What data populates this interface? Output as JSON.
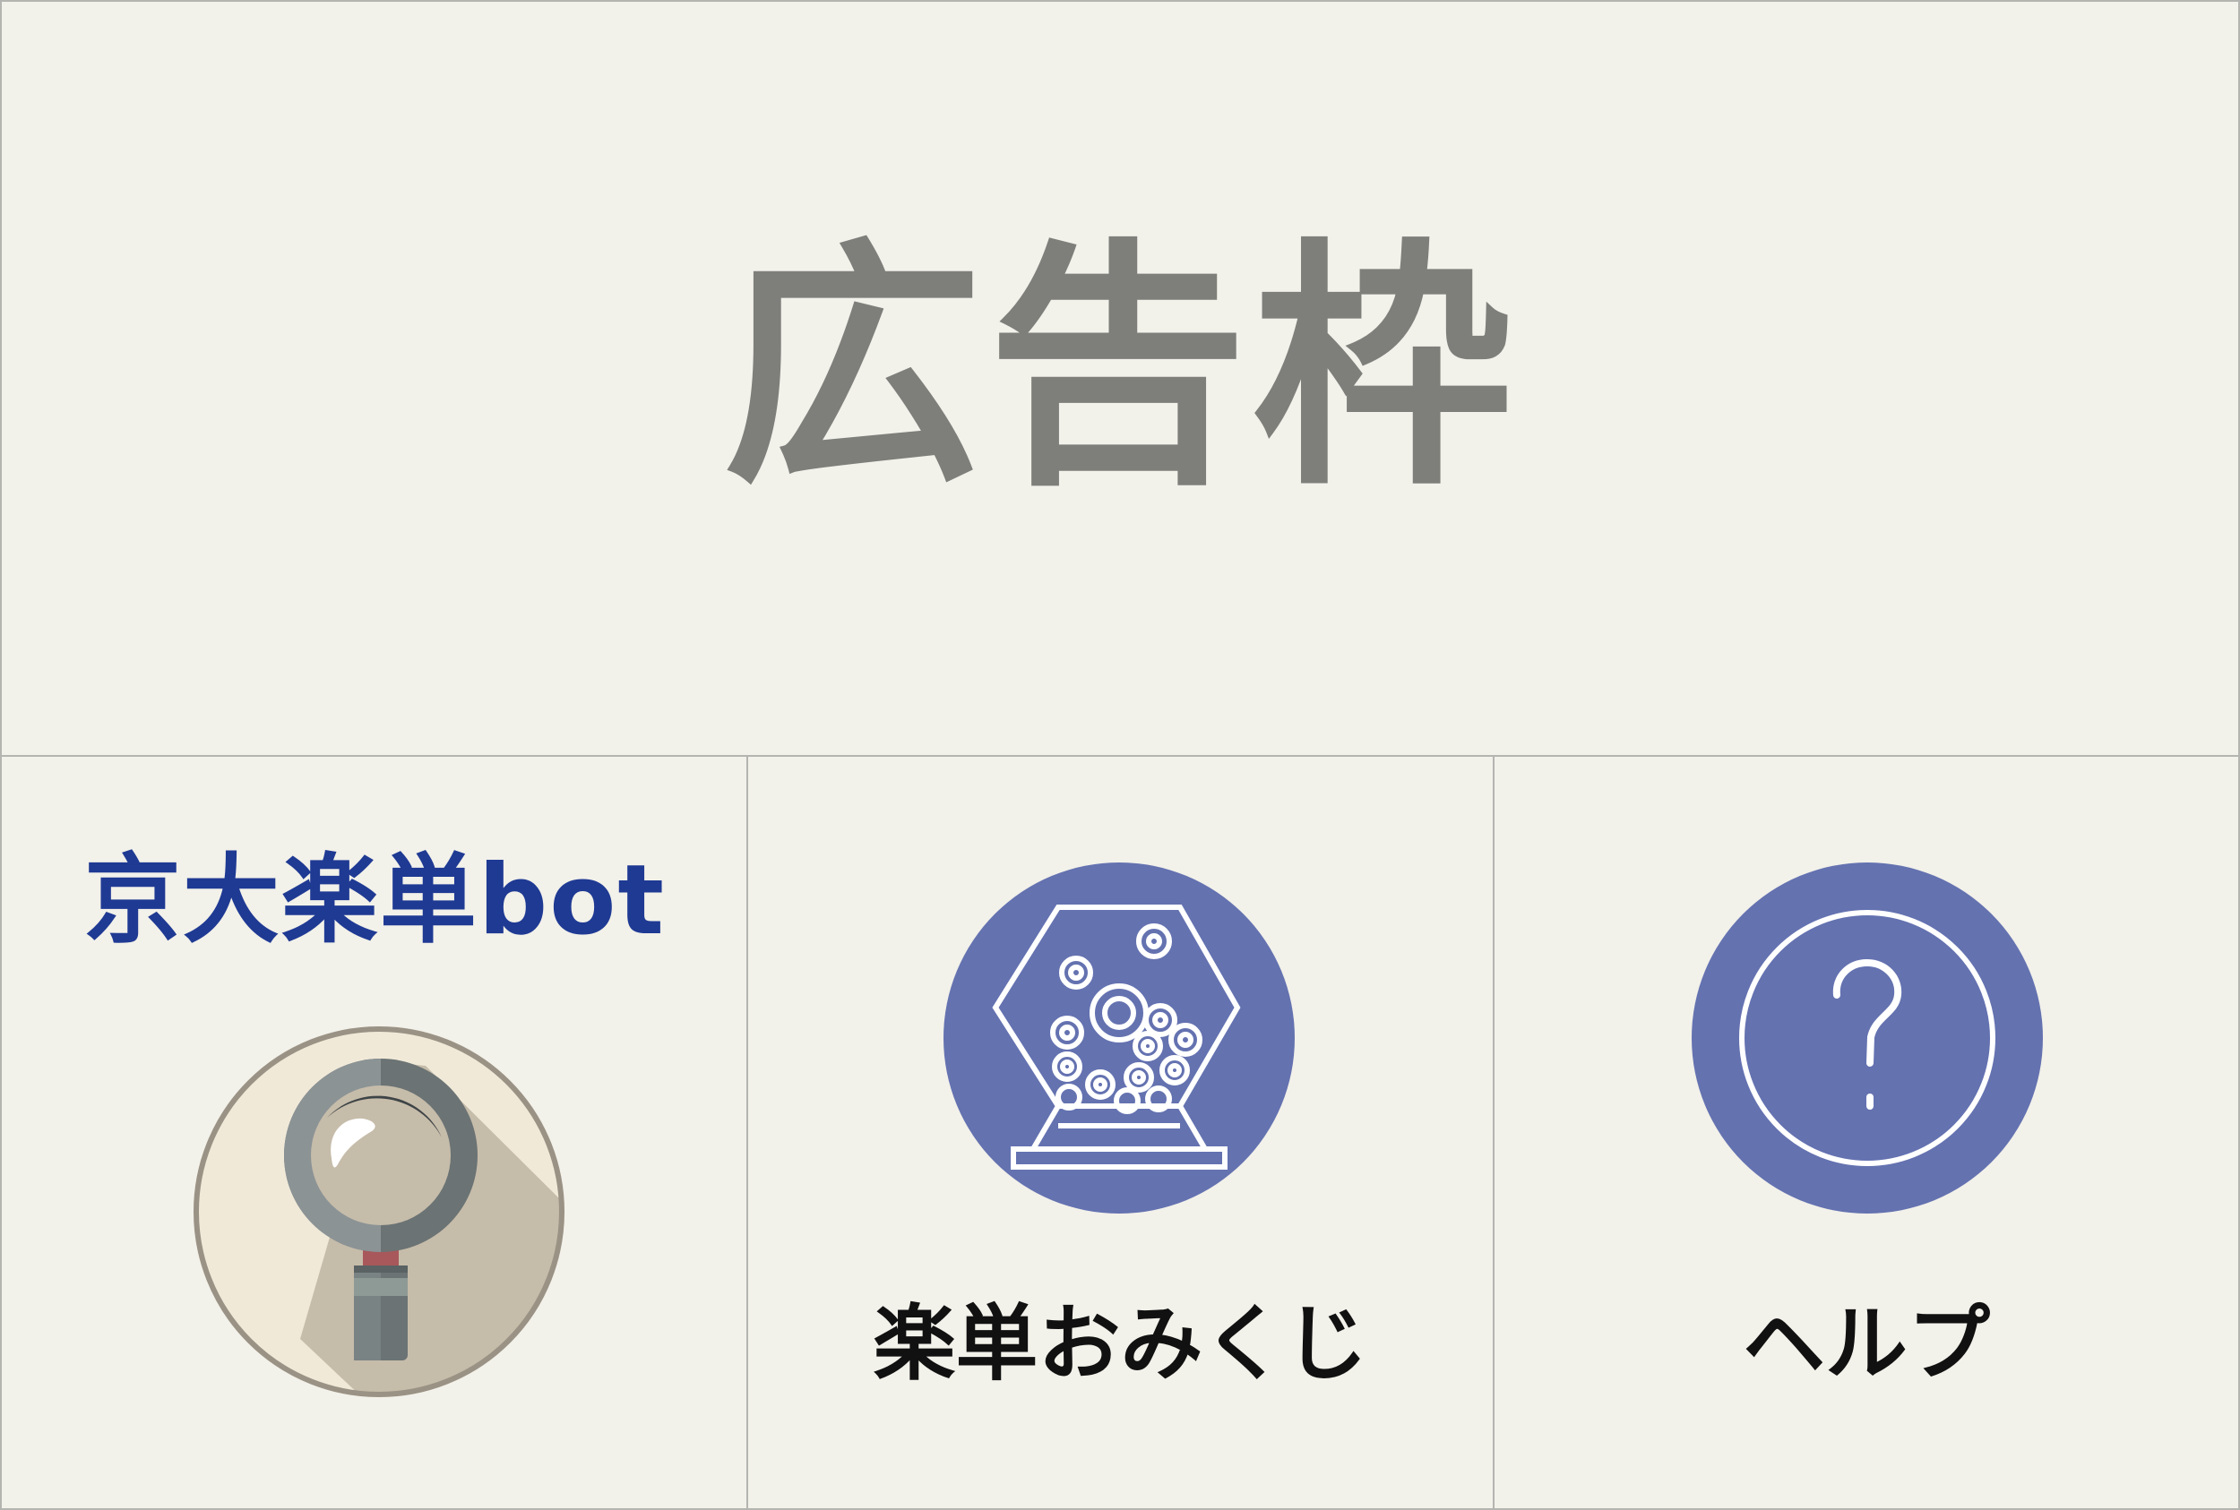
{
  "ad_slot": {
    "label": "広告枠"
  },
  "menu": {
    "items": [
      {
        "label": "京大楽単bot",
        "icon": "search-icon"
      },
      {
        "label": "楽単おみくじ",
        "icon": "lottery-icon"
      },
      {
        "label": "ヘルプ",
        "icon": "help-icon"
      }
    ]
  },
  "colors": {
    "background": "#f2f1ea",
    "ad_text": "#7e7f7a",
    "title_blue": "#1f3a93",
    "circle_blue": "#6472b0"
  }
}
